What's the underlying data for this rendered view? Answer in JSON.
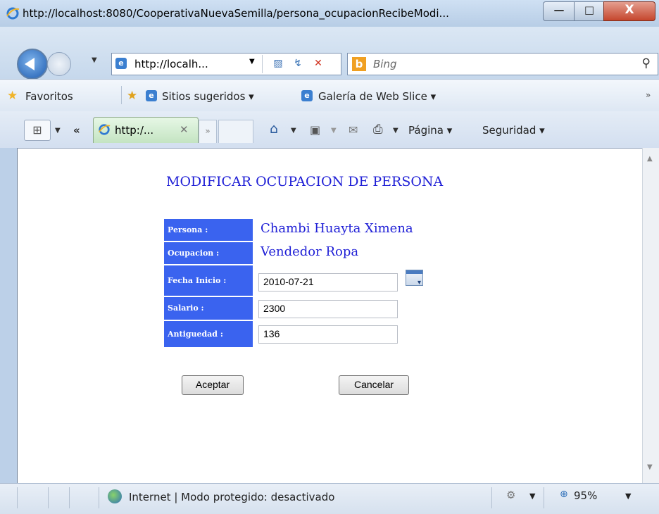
{
  "titlebar": {
    "title": "http://localhost:8080/CooperativaNuevaSemilla/persona_ocupacionRecibeModi..."
  },
  "nav": {
    "address": "http://localh...",
    "search_placeholder": "Bing",
    "search_icon_glyph": "⚲"
  },
  "favorites": {
    "favorites_label": "Favoritos",
    "suggested_label": "Sitios sugeridos ▾",
    "slice_label": "Galería de Web Slice ▾",
    "more_glyph": "»"
  },
  "tabs": {
    "tab_title": "http:/...",
    "tab_close": "✕",
    "page_menu": "Página ▾",
    "security_menu": "Seguridad ▾"
  },
  "form": {
    "heading": "MODIFICAR OCUPACION DE PERSONA",
    "persona_label": "Persona :",
    "persona_value": "Chambi Huayta Ximena",
    "ocupacion_label": "Ocupacion :",
    "ocupacion_value": "Vendedor Ropa",
    "fecha_label": "Fecha Inicio :",
    "fecha_value": "2010-07-21",
    "salario_label": "Salario :",
    "salario_value": "2300",
    "antiguedad_label": "Antiguedad :",
    "antiguedad_value": "136",
    "accept_label": "Aceptar",
    "cancel_label": "Cancelar"
  },
  "status": {
    "zone_text": "Internet | Modo protegido: desactivado",
    "zoom": "95%"
  },
  "colors": {
    "label_bg": "#3a63ef",
    "heading": "#1f1fd6"
  }
}
